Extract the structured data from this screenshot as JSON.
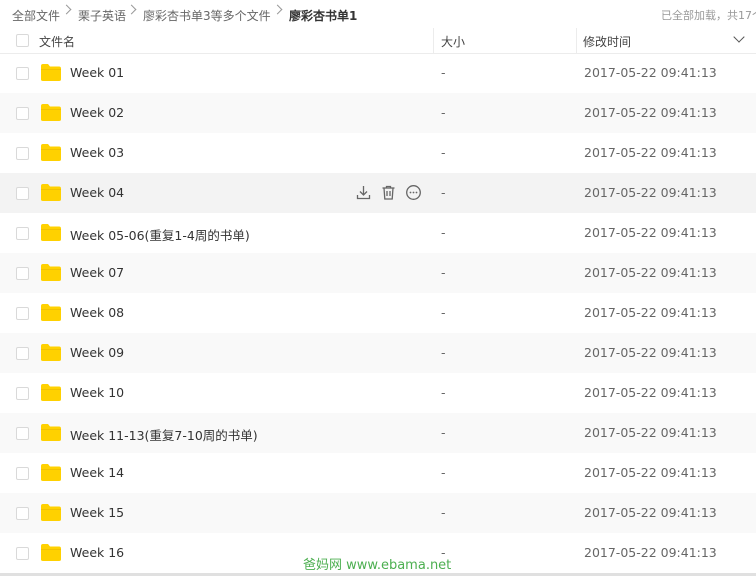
{
  "breadcrumb": [
    {
      "label": "全部文件"
    },
    {
      "label": "栗子英语"
    },
    {
      "label": "廖彩杏书单3等多个文件"
    },
    {
      "label": "廖彩杏书单1"
    }
  ],
  "status_text": "已全部加载，共17个",
  "columns": {
    "name": "文件名",
    "size": "大小",
    "modified": "修改时间"
  },
  "accent_color": "#ffd100",
  "icons": {
    "folder": "folder-icon",
    "download": "download-icon",
    "delete": "delete-icon",
    "more": "more-icon"
  },
  "rows": [
    {
      "name": "Week 01",
      "size": "-",
      "modified": "2017-05-22 09:41:13"
    },
    {
      "name": "Week 02",
      "size": "-",
      "modified": "2017-05-22 09:41:13"
    },
    {
      "name": "Week 03",
      "size": "-",
      "modified": "2017-05-22 09:41:13"
    },
    {
      "name": "Week 04",
      "size": "-",
      "modified": "2017-05-22 09:41:13",
      "hovered": true
    },
    {
      "name": "Week 05-06(重复1-4周的书单)",
      "size": "-",
      "modified": "2017-05-22 09:41:13"
    },
    {
      "name": "Week 07",
      "size": "-",
      "modified": "2017-05-22 09:41:13"
    },
    {
      "name": "Week 08",
      "size": "-",
      "modified": "2017-05-22 09:41:13"
    },
    {
      "name": "Week 09",
      "size": "-",
      "modified": "2017-05-22 09:41:13"
    },
    {
      "name": "Week 10",
      "size": "-",
      "modified": "2017-05-22 09:41:13"
    },
    {
      "name": "Week 11-13(重复7-10周的书单)",
      "size": "-",
      "modified": "2017-05-22 09:41:13"
    },
    {
      "name": "Week 14",
      "size": "-",
      "modified": "2017-05-22 09:41:13"
    },
    {
      "name": "Week 15",
      "size": "-",
      "modified": "2017-05-22 09:41:13"
    },
    {
      "name": "Week 16",
      "size": "-",
      "modified": "2017-05-22 09:41:13"
    }
  ],
  "watermark": "爸妈网 www.ebama.net"
}
